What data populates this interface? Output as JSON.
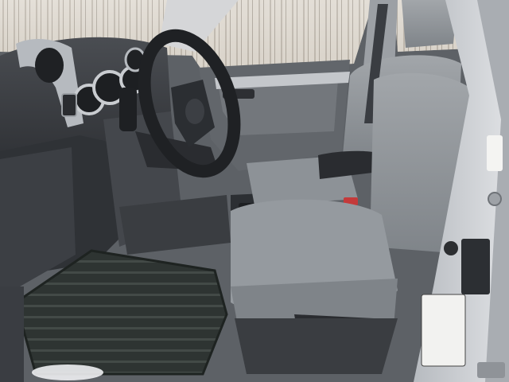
{
  "scene": {
    "subject": "car-interior-front-seats",
    "visible_text": []
  },
  "colors": {
    "snow_sky": "#e9e6e0",
    "trees": "#b9b1a6",
    "dash_dark": "#3a3c40",
    "dash_mid": "#55585d",
    "trim_silver": "#b9bdc2",
    "seat_gray": "#8c9196",
    "seat_light": "#a3a7ab",
    "floor_mat": "#2f3533",
    "door_panel": "#6f7378",
    "door_silver": "#c8cbcf"
  }
}
